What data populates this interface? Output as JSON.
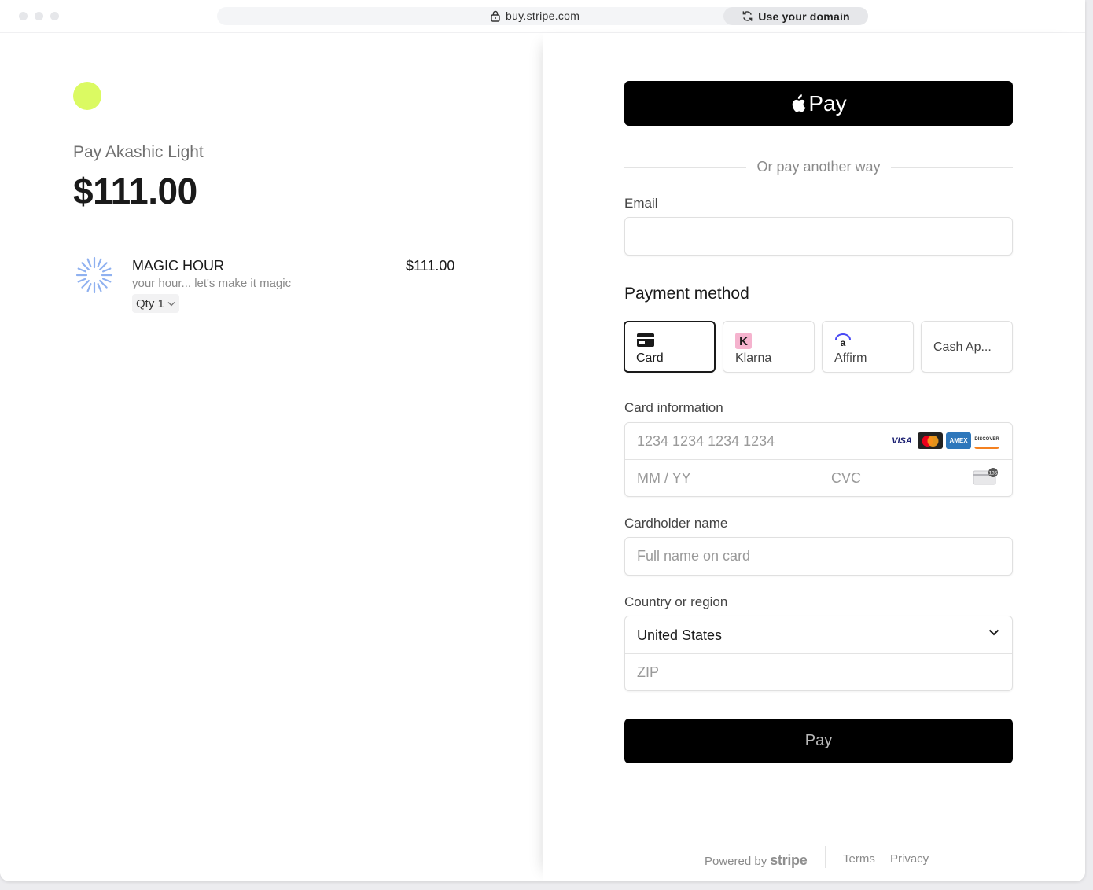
{
  "browser": {
    "url": "buy.stripe.com",
    "domain_button": "Use your domain"
  },
  "summary": {
    "merchant_line": "Pay Akashic Light",
    "total": "$111.00",
    "item": {
      "name": "MAGIC HOUR",
      "description": "your hour... let's make it magic",
      "qty_label": "Qty 1",
      "price": "$111.00"
    }
  },
  "checkout": {
    "apple_pay_label": "Pay",
    "divider_text": "Or pay another way",
    "email_label": "Email",
    "email_value": "",
    "payment_method_title": "Payment method",
    "payment_methods": [
      {
        "label": "Card",
        "selected": true
      },
      {
        "label": "Klarna",
        "selected": false
      },
      {
        "label": "Affirm",
        "selected": false
      },
      {
        "label": "Cash Ap...",
        "selected": false
      }
    ],
    "card_info_label": "Card information",
    "card_number_placeholder": "1234 1234 1234 1234",
    "expiry_placeholder": "MM / YY",
    "cvc_placeholder": "CVC",
    "card_brands": [
      "VISA",
      "Mastercard",
      "AMEX",
      "DISCOVER"
    ],
    "cvc_hint": "135",
    "cardholder_label": "Cardholder name",
    "cardholder_placeholder": "Full name on card",
    "country_label": "Country or region",
    "country_value": "United States",
    "zip_placeholder": "ZIP",
    "pay_button": "Pay"
  },
  "footer": {
    "powered_by": "Powered by",
    "brand": "stripe",
    "terms": "Terms",
    "privacy": "Privacy"
  },
  "colors": {
    "logo_accent": "#dbfa62",
    "button_bg": "#000000"
  }
}
